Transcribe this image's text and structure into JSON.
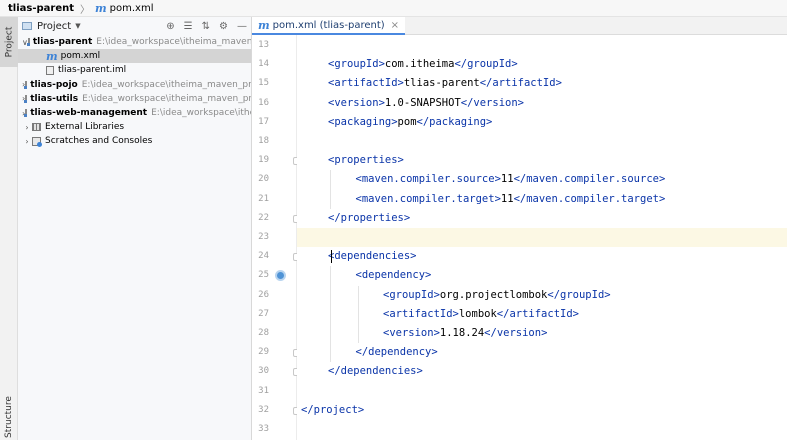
{
  "breadcrumb": {
    "project": "tlias-parent",
    "separator": "〉",
    "file": "pom.xml"
  },
  "side_tabs": {
    "project": "Project",
    "structure": "Structure"
  },
  "project_panel": {
    "title": "Project",
    "tools": [
      "⊕",
      "☰",
      "⇅",
      "⚙",
      "—"
    ],
    "tree": [
      {
        "indent": 0,
        "arrow": "∨",
        "icon": "module-folder",
        "name": "tlias-parent",
        "bold": true,
        "path": "E:\\idea_workspace\\itheima_maven_p",
        "selected": false
      },
      {
        "indent": 1,
        "arrow": "",
        "icon": "maven",
        "name": "pom.xml",
        "bold": false,
        "path": "",
        "selected": true
      },
      {
        "indent": 1,
        "arrow": "",
        "icon": "iml",
        "name": "tlias-parent.iml",
        "bold": false,
        "path": "",
        "selected": false
      },
      {
        "indent": 0,
        "arrow": "›",
        "icon": "module-folder",
        "name": "tlias-pojo",
        "bold": true,
        "path": "E:\\idea_workspace\\itheima_maven_pro",
        "selected": false
      },
      {
        "indent": 0,
        "arrow": "›",
        "icon": "module-folder",
        "name": "tlias-utils",
        "bold": true,
        "path": "E:\\idea_workspace\\itheima_maven_pro",
        "selected": false
      },
      {
        "indent": 0,
        "arrow": "›",
        "icon": "module-folder",
        "name": "tlias-web-management",
        "bold": true,
        "path": "E:\\idea_workspace\\itheima_maven_pro",
        "selected": false
      },
      {
        "indent": 0,
        "arrow": "›",
        "icon": "library",
        "name": "External Libraries",
        "bold": false,
        "path": "",
        "selected": false
      },
      {
        "indent": 0,
        "arrow": "›",
        "icon": "scratches",
        "name": "Scratches and Consoles",
        "bold": false,
        "path": "",
        "selected": false
      }
    ]
  },
  "editor": {
    "tab": {
      "label": "pom.xml (tlias-parent)",
      "close": "×"
    },
    "lines": [
      {
        "n": "13",
        "indent": 0,
        "parts": []
      },
      {
        "n": "14",
        "indent": 1,
        "parts": [
          [
            "t",
            "<groupId>"
          ],
          [
            "x",
            "com.itheima"
          ],
          [
            "t",
            "</groupId>"
          ]
        ]
      },
      {
        "n": "15",
        "indent": 1,
        "parts": [
          [
            "t",
            "<artifactId>"
          ],
          [
            "x",
            "tlias-parent"
          ],
          [
            "t",
            "</artifactId>"
          ]
        ]
      },
      {
        "n": "16",
        "indent": 1,
        "parts": [
          [
            "t",
            "<version>"
          ],
          [
            "x",
            "1.0-SNAPSHOT"
          ],
          [
            "t",
            "</version>"
          ]
        ]
      },
      {
        "n": "17",
        "indent": 1,
        "parts": [
          [
            "t",
            "<packaging>"
          ],
          [
            "x",
            "pom"
          ],
          [
            "t",
            "</packaging>"
          ]
        ]
      },
      {
        "n": "18",
        "indent": 0,
        "parts": []
      },
      {
        "n": "19",
        "indent": 1,
        "parts": [
          [
            "t",
            "<properties>"
          ]
        ]
      },
      {
        "n": "20",
        "indent": 2,
        "parts": [
          [
            "t",
            "<maven.compiler.source>"
          ],
          [
            "x",
            "11"
          ],
          [
            "t",
            "</maven.compiler.source>"
          ]
        ]
      },
      {
        "n": "21",
        "indent": 2,
        "parts": [
          [
            "t",
            "<maven.compiler.target>"
          ],
          [
            "x",
            "11"
          ],
          [
            "t",
            "</maven.compiler.target>"
          ]
        ]
      },
      {
        "n": "22",
        "indent": 1,
        "parts": [
          [
            "t",
            "</properties>"
          ]
        ]
      },
      {
        "n": "23",
        "indent": 0,
        "parts": []
      },
      {
        "n": "24",
        "indent": 1,
        "parts": [
          [
            "t",
            "<dependencies>"
          ]
        ]
      },
      {
        "n": "25",
        "indent": 2,
        "parts": [
          [
            "t",
            "<dependency>"
          ]
        ]
      },
      {
        "n": "26",
        "indent": 3,
        "parts": [
          [
            "t",
            "<groupId>"
          ],
          [
            "x",
            "org.projectlombok"
          ],
          [
            "t",
            "</groupId>"
          ]
        ]
      },
      {
        "n": "27",
        "indent": 3,
        "parts": [
          [
            "t",
            "<artifactId>"
          ],
          [
            "x",
            "lombok"
          ],
          [
            "t",
            "</artifactId>"
          ]
        ]
      },
      {
        "n": "28",
        "indent": 3,
        "parts": [
          [
            "t",
            "<version>"
          ],
          [
            "x",
            "1.18.24"
          ],
          [
            "t",
            "</version>"
          ]
        ]
      },
      {
        "n": "29",
        "indent": 2,
        "parts": [
          [
            "t",
            "</dependency>"
          ]
        ]
      },
      {
        "n": "30",
        "indent": 1,
        "parts": [
          [
            "t",
            "</dependencies>"
          ]
        ]
      },
      {
        "n": "31",
        "indent": 0,
        "parts": []
      },
      {
        "n": "32",
        "indent": 0,
        "parts": [
          [
            "t",
            "</project>"
          ]
        ]
      },
      {
        "n": "33",
        "indent": 0,
        "parts": []
      }
    ]
  },
  "colors": {
    "tag": "#0a34a8",
    "text": "#000000",
    "current_line": "#fcf8e4",
    "selection": "#d4d4d4"
  }
}
